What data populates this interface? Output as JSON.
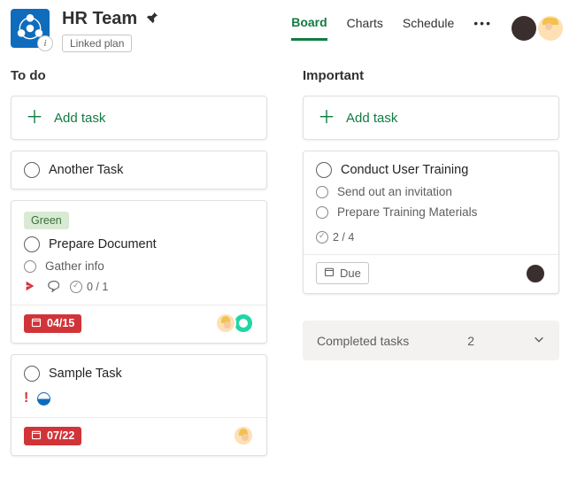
{
  "header": {
    "plan_title": "HR Team",
    "linked_label": "Linked plan",
    "tabs": {
      "board": "Board",
      "charts": "Charts",
      "schedule": "Schedule"
    }
  },
  "columns": {
    "todo": {
      "name": "To do",
      "add_label": "Add task",
      "cards": [
        {
          "title": "Another Task"
        },
        {
          "label": "Green",
          "title": "Prepare Document",
          "subtasks": [
            "Gather info"
          ],
          "checklist_done": "0",
          "checklist_total": "1",
          "checklist_display": "0 / 1",
          "due": "04/15"
        },
        {
          "title": "Sample Task",
          "due": "07/22"
        }
      ]
    },
    "important": {
      "name": "Important",
      "add_label": "Add task",
      "cards": [
        {
          "title": "Conduct User Training",
          "subtasks": [
            "Send out an invitation",
            "Prepare Training Materials"
          ],
          "checklist_done": "2",
          "checklist_total": "4",
          "checklist_display": "2 / 4",
          "due_label": "Due"
        }
      ],
      "completed": {
        "label": "Completed tasks",
        "count": "2"
      }
    }
  }
}
